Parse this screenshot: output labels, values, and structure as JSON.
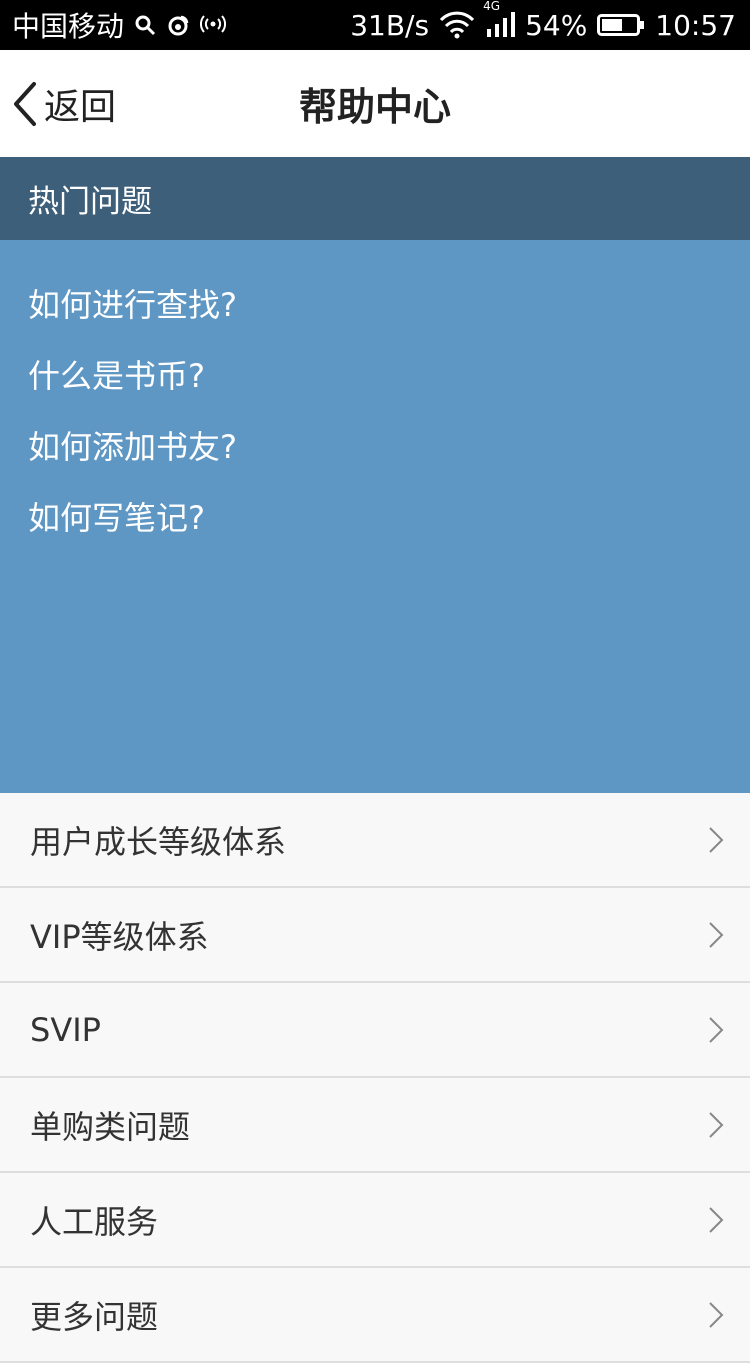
{
  "status_bar": {
    "carrier": "中国移动",
    "speed": "31B/s",
    "network": "4G",
    "battery": "54%",
    "time": "10:57"
  },
  "nav": {
    "back_label": "返回",
    "title": "帮助中心"
  },
  "hot": {
    "header": "热门问题",
    "items": [
      "如何进行查找?",
      "什么是书币?",
      "如何添加书友?",
      "如何写笔记?"
    ]
  },
  "menu": {
    "items": [
      "用户成长等级体系",
      "VIP等级体系",
      "SVIP",
      "单购类问题",
      "人工服务",
      "更多问题"
    ]
  },
  "colors": {
    "hot_header_bg": "#3d5f7a",
    "hot_panel_bg": "#5e96c4",
    "list_bg": "#f8f8f8"
  }
}
